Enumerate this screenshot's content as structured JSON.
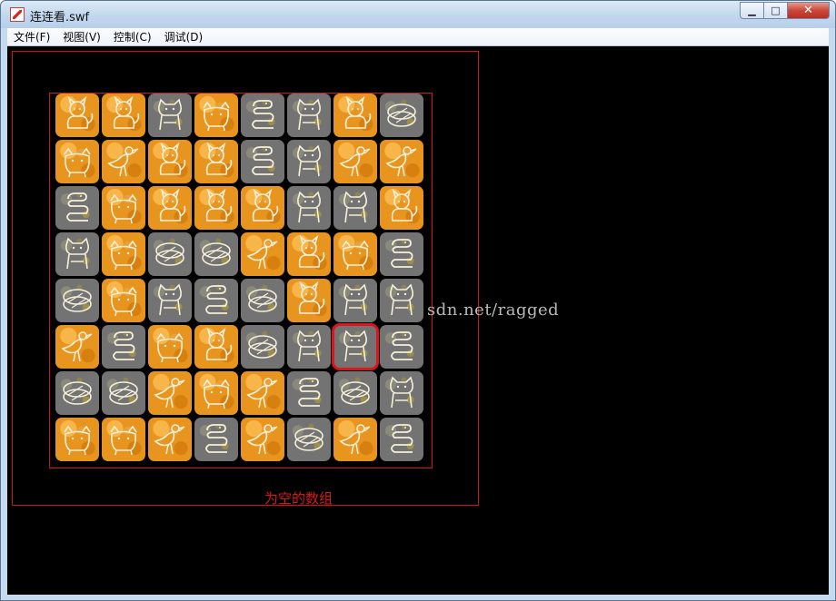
{
  "window": {
    "title": "连连看.swf",
    "minimize_label": "▁",
    "maximize_label": "□",
    "close_label": "✕"
  },
  "menu": [
    {
      "label": "文件(F)"
    },
    {
      "label": "视图(V)"
    },
    {
      "label": "控制(C)"
    },
    {
      "label": "调试(D)"
    }
  ],
  "game": {
    "caption": "为空的数组",
    "watermark": "sdn.net/ragged",
    "colors": {
      "frame": "#d0161c",
      "orange_tile": "#e8951f",
      "gray_tile": "#737373",
      "icon_stroke": "#f5f0d8",
      "selection": "#e0121a"
    },
    "selected": {
      "row": 5,
      "col": 6
    },
    "board": [
      [
        [
          "orange",
          "cat"
        ],
        [
          "orange",
          "cat"
        ],
        [
          "gray",
          "dog"
        ],
        [
          "orange",
          "cow"
        ],
        [
          "gray",
          "snake"
        ],
        [
          "gray",
          "dog"
        ],
        [
          "orange",
          "cat"
        ],
        [
          "gray",
          "egg"
        ]
      ],
      [
        [
          "orange",
          "cow"
        ],
        [
          "orange",
          "bird"
        ],
        [
          "orange",
          "cat"
        ],
        [
          "orange",
          "cat"
        ],
        [
          "gray",
          "snake"
        ],
        [
          "gray",
          "dog"
        ],
        [
          "orange",
          "bird"
        ],
        [
          "orange",
          "bird"
        ]
      ],
      [
        [
          "gray",
          "snake"
        ],
        [
          "orange",
          "cow"
        ],
        [
          "orange",
          "cat"
        ],
        [
          "orange",
          "cat"
        ],
        [
          "orange",
          "cat"
        ],
        [
          "gray",
          "dog"
        ],
        [
          "gray",
          "dog"
        ],
        [
          "orange",
          "cat"
        ]
      ],
      [
        [
          "gray",
          "dog"
        ],
        [
          "orange",
          "cow"
        ],
        [
          "gray",
          "egg"
        ],
        [
          "gray",
          "egg"
        ],
        [
          "orange",
          "bird"
        ],
        [
          "orange",
          "cat"
        ],
        [
          "orange",
          "cow"
        ],
        [
          "gray",
          "snake"
        ]
      ],
      [
        [
          "gray",
          "egg"
        ],
        [
          "orange",
          "cow"
        ],
        [
          "gray",
          "dog"
        ],
        [
          "gray",
          "snake"
        ],
        [
          "gray",
          "egg"
        ],
        [
          "orange",
          "cat"
        ],
        [
          "gray",
          "dog"
        ],
        [
          "gray",
          "dog"
        ]
      ],
      [
        [
          "orange",
          "bird"
        ],
        [
          "gray",
          "snake"
        ],
        [
          "orange",
          "cow"
        ],
        [
          "orange",
          "cat"
        ],
        [
          "gray",
          "egg"
        ],
        [
          "gray",
          "dog"
        ],
        [
          "gray",
          "dog"
        ],
        [
          "gray",
          "snake"
        ]
      ],
      [
        [
          "gray",
          "egg"
        ],
        [
          "gray",
          "egg"
        ],
        [
          "orange",
          "bird"
        ],
        [
          "orange",
          "cow"
        ],
        [
          "orange",
          "bird"
        ],
        [
          "gray",
          "snake"
        ],
        [
          "gray",
          "egg"
        ],
        [
          "gray",
          "dog"
        ]
      ],
      [
        [
          "orange",
          "cow"
        ],
        [
          "orange",
          "cow"
        ],
        [
          "orange",
          "bird"
        ],
        [
          "gray",
          "snake"
        ],
        [
          "orange",
          "bird"
        ],
        [
          "gray",
          "egg"
        ],
        [
          "orange",
          "bird"
        ],
        [
          "gray",
          "snake"
        ]
      ]
    ]
  }
}
